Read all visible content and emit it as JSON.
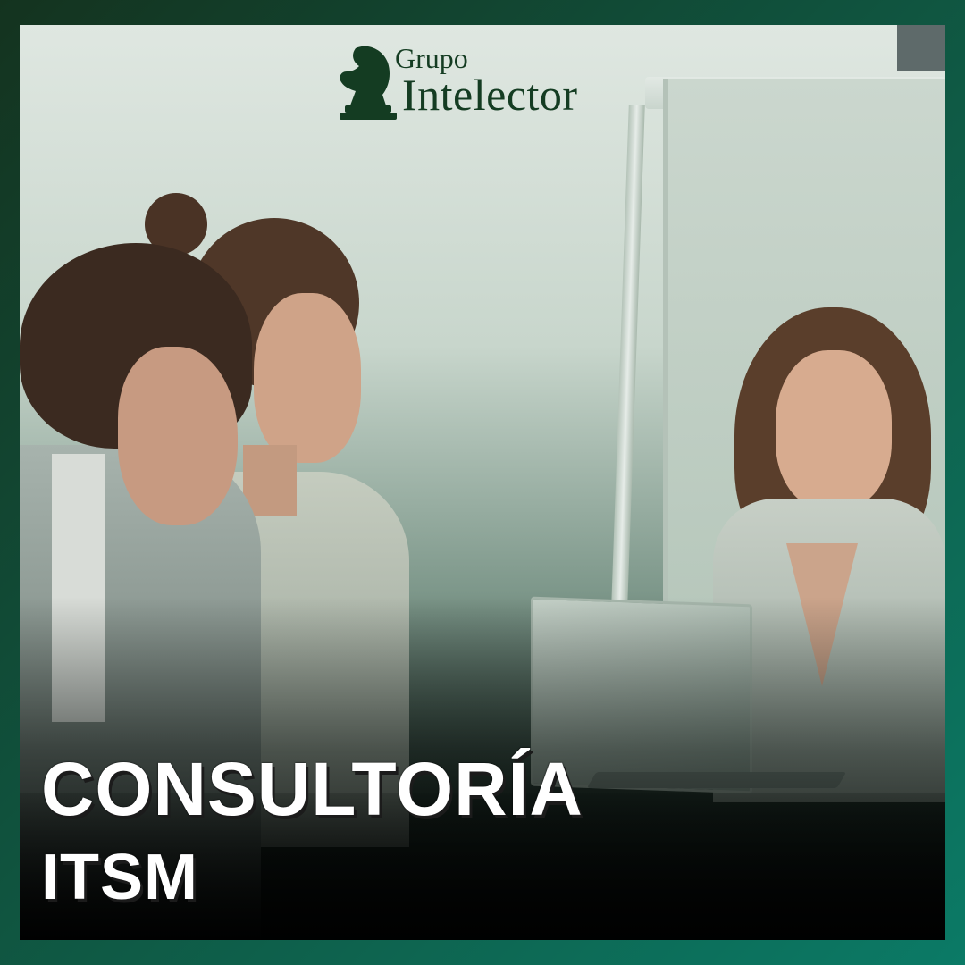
{
  "brand": {
    "logo_line1": "Grupo",
    "logo_line2": "Intelector",
    "logo_icon": "chess-knight-icon",
    "color": "#143c22"
  },
  "headline": "CONSULTORÍA",
  "subheadline": "ITSM",
  "colors": {
    "frame_dark": "#14331f",
    "frame_teal": "#0b7a66",
    "text": "#ffffff"
  }
}
